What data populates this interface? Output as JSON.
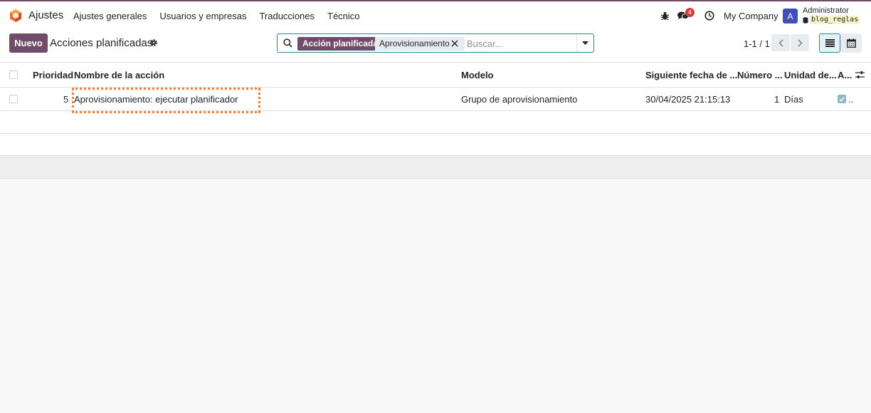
{
  "navbar": {
    "app_name": "Ajustes",
    "menu": [
      "Ajustes generales",
      "Usuarios y empresas",
      "Traducciones",
      "Técnico"
    ],
    "messages_count": "4",
    "company": "My Company",
    "avatar_letter": "A",
    "user_name": "Administrator",
    "database": "blog_reglas",
    "brand_color": "#714b67"
  },
  "control": {
    "new_label": "Nuevo",
    "title": "Acciones planificadas",
    "facet_label": "Acción planificada",
    "facet_value": "Aprovisionamiento",
    "search_placeholder": "Buscar...",
    "pager": "1-1 / 1"
  },
  "table": {
    "columns": [
      "Prioridad",
      "Nombre de la acción",
      "Modelo",
      "Siguiente fecha de ...",
      "Número ...",
      "Unidad de...",
      "A..."
    ],
    "rows": [
      {
        "priority": "5",
        "name": "Aprovisionamiento: ejecutar planificador",
        "model": "Grupo de aprovisionamiento",
        "next_date": "30/04/2025 21:15:13",
        "number": "1",
        "unit": "Días",
        "active_suffix": ".."
      }
    ]
  }
}
